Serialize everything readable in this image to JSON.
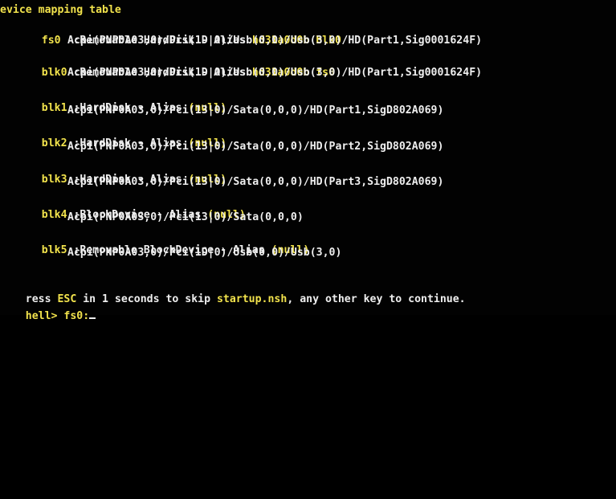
{
  "header": "evice mapping table",
  "mappings": [
    {
      "name": "fs0",
      "desc_prefix": ":Removable HardDisk - ",
      "alias_label": "Alias",
      "alias_value": "hd31a0d0b blk0",
      "path": "Acpi(PNP0A03,0)/Pci(1D|0)/Usb(0,0)/Usb(3,0)/HD(Part1,Sig0001624F)"
    },
    {
      "name": "blk0",
      "desc_prefix": ":Removable HardDisk - ",
      "alias_label": "Alias",
      "alias_value": "hd31a0d0b fs0",
      "path": "Acpi(PNP0A03,0)/Pci(1D|0)/Usb(0,0)/Usb(3,0)/HD(Part1,Sig0001624F)"
    },
    {
      "name": "blk1",
      "desc_prefix": ":HardDisk - ",
      "alias_label": "Alias",
      "alias_value": "(null)",
      "path": "Acpi(PNP0A03,0)/Pci(13|0)/Sata(0,0,0)/HD(Part1,SigD802A069)"
    },
    {
      "name": "blk2",
      "desc_prefix": ":HardDisk - ",
      "alias_label": "Alias",
      "alias_value": "(null)",
      "path": "Acpi(PNP0A03,0)/Pci(13|0)/Sata(0,0,0)/HD(Part2,SigD802A069)"
    },
    {
      "name": "blk3",
      "desc_prefix": ":HardDisk - ",
      "alias_label": "Alias",
      "alias_value": "(null)",
      "path": "Acpi(PNP0A03,0)/Pci(13|0)/Sata(0,0,0)/HD(Part3,SigD802A069)"
    },
    {
      "name": "blk4",
      "desc_prefix": ":BlockDevice - ",
      "alias_label": "Alias",
      "alias_value": "(null)",
      "path": "Acpi(PNP0A03,0)/Pci(13|0)/Sata(0,0,0)"
    },
    {
      "name": "blk5",
      "desc_prefix": ":Removable BlockDevice - ",
      "alias_label": "Alias",
      "alias_value": "(null)",
      "path": "Acpi(PNP0A03,0)/Pci(1D|0)/Usb(0,0)/Usb(3,0)"
    }
  ],
  "footer": {
    "press_prefix": "ress ",
    "esc_key": "ESC",
    "press_middle": " in 1 seconds to skip ",
    "script_name": "startup.nsh",
    "press_suffix": ", any other key to continue."
  },
  "prompt": {
    "label": "hell> ",
    "command": "fs0:"
  },
  "colors": {
    "background": "#020202",
    "text": "#eeeeee",
    "highlight": "#f1e24c"
  }
}
